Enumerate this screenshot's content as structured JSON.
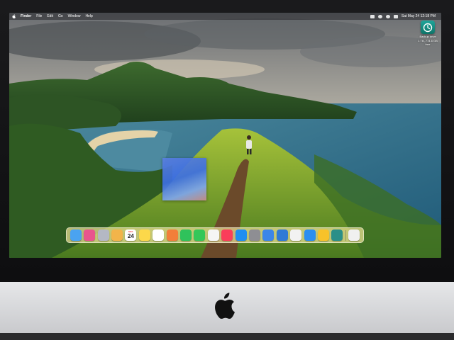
{
  "menubar": {
    "app_name": "Finder",
    "items": [
      "File",
      "Edit",
      "Go",
      "Window",
      "Help"
    ],
    "clock": "Sat May 24  12:18 PM"
  },
  "desktop_icon": {
    "label": "Backup drive",
    "sublabel": "1 TB, 774.6 GB free",
    "icon": "time-machine-icon",
    "color": "#1fa59a"
  },
  "calendar": {
    "month": "MAY",
    "day": "24"
  },
  "dock": {
    "apps": [
      {
        "name": "finder-icon",
        "color": "#4aa3f0"
      },
      {
        "name": "launchpad-icon",
        "color": "#e9548d"
      },
      {
        "name": "app-grid-icon",
        "color": "#b4b8c4"
      },
      {
        "name": "contacts-icon",
        "color": "#f2b44a"
      },
      {
        "name": "calendar-icon",
        "color": "#ffffff"
      },
      {
        "name": "notes-icon",
        "color": "#fcd84a"
      },
      {
        "name": "reminders-icon",
        "color": "#ffffff"
      },
      {
        "name": "photos-icon",
        "color": "#f27e3a"
      },
      {
        "name": "facetime-icon",
        "color": "#2fc25b"
      },
      {
        "name": "messages-icon",
        "color": "#34c759"
      },
      {
        "name": "news-icon",
        "color": "#f5f5f5"
      },
      {
        "name": "music-icon",
        "color": "#fa3e5a"
      },
      {
        "name": "app-store-icon",
        "color": "#1f8ef1"
      },
      {
        "name": "settings-icon",
        "color": "#8e8e93"
      },
      {
        "name": "keynote-icon",
        "color": "#3b86e8"
      },
      {
        "name": "remote-desktop-icon",
        "color": "#2f7ad6"
      },
      {
        "name": "chrome-icon",
        "color": "#f2f2f2"
      },
      {
        "name": "safari-icon",
        "color": "#2b8ef0"
      },
      {
        "name": "tips-icon",
        "color": "#f7c22a"
      },
      {
        "name": "time-machine-icon",
        "color": "#2a8f88"
      },
      {
        "name": "trash-icon",
        "color": "#f0f0f0"
      }
    ]
  }
}
